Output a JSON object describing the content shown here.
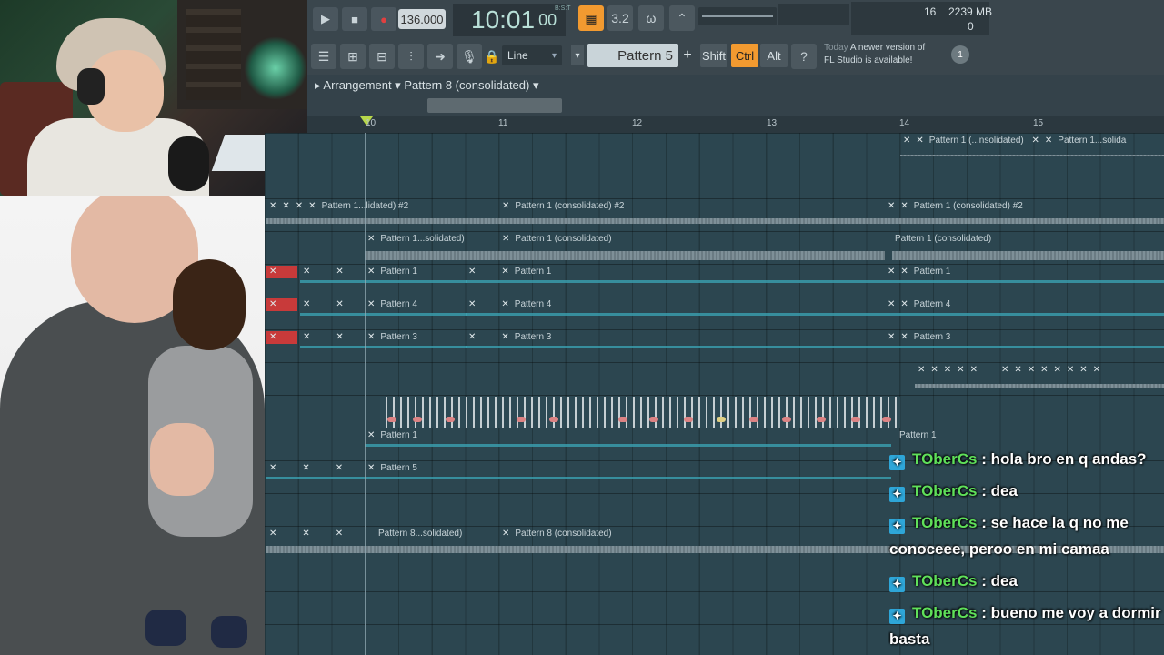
{
  "transport": {
    "play_icon": "play-icon",
    "stop_icon": "stop-icon",
    "record_icon": "record-icon",
    "tempo": "136.000",
    "time": "10:01",
    "time_frac": "00",
    "time_sub": "B:S:T"
  },
  "perf": {
    "cpu_count": "16",
    "memory": "2239 MB",
    "polyphony": "0"
  },
  "toolbar2": {
    "snap_value": "Line",
    "pattern": "Pattern 5",
    "plus": "+",
    "shift": "Shift",
    "ctrl": "Ctrl",
    "alt": "Alt",
    "notice_label": "Today",
    "notice_line1": "A newer version of",
    "notice_line2": "FL Studio is available!",
    "notice_count": "1"
  },
  "playlist": {
    "title": "▸ Arrangement ▾ Pattern 8 (consolidated) ▾",
    "ruler": [
      "10",
      "11",
      "12",
      "13",
      "14",
      "15"
    ]
  },
  "clips": {
    "p1lidated2_a": "Pattern 1...lidated) #2",
    "p1cons2_a": "Pattern 1 (consolidated) #2",
    "p1cons2_b": "Pattern 1 (consolidated) #2",
    "p1solidated_a": "Pattern 1...solidated)",
    "p1cons_a": "Pattern 1 (consolidated)",
    "p1cons_b": "Pattern 1 (consolidated)",
    "p1cons_top": "Pattern 1 (...nsolidated)",
    "p1cons_top2": "Pattern 1...solida",
    "pattern1": "Pattern 1",
    "pattern4": "Pattern 4",
    "pattern3": "Pattern 3",
    "pattern5": "Pattern 5",
    "p8solidated": "Pattern 8...solidated)",
    "p8cons": "Pattern 8 (consolidated)"
  },
  "chat": [
    {
      "user": "TOberCs",
      "text": " : hola bro en q andas?"
    },
    {
      "user": "TOberCs",
      "text": " : dea"
    },
    {
      "user": "TOberCs",
      "text": " : se hace la q no me conoceee, peroo en mi camaa"
    },
    {
      "user": "TOberCs",
      "text": " : dea"
    },
    {
      "user": "TOberCs",
      "text": " : bueno me voy a dormir basta"
    }
  ],
  "colors": {
    "accent_orange": "#f29a30",
    "chat_user": "#5fe05a",
    "badge": "#2ea6d8",
    "clip_red": "#c83a3a"
  }
}
